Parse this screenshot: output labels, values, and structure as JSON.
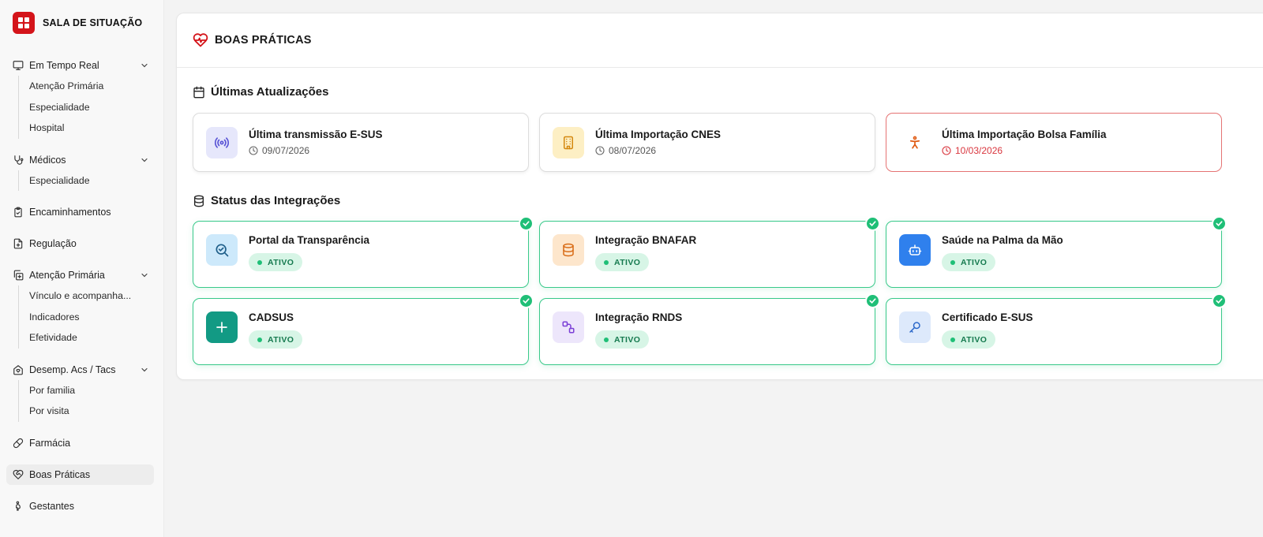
{
  "sidebar": {
    "brand": "SALA DE SITUAÇÃO",
    "groups": [
      {
        "label": "Em Tempo Real",
        "icon": "monitor-icon",
        "items": [
          "Atenção Primária",
          "Especialidade",
          "Hospital"
        ]
      },
      {
        "label": "Médicos",
        "icon": "stethoscope-icon",
        "items": [
          "Especialidade"
        ]
      },
      {
        "label": "Encaminhamentos",
        "icon": "clipboard-icon"
      },
      {
        "label": "Regulação",
        "icon": "file-plus-icon"
      },
      {
        "label": "Atenção Primária",
        "icon": "copy-plus-icon",
        "items": [
          "Vínculo e acompanha...",
          "Indicadores",
          "Efetividade"
        ]
      },
      {
        "label": "Desemp. Acs / Tacs",
        "icon": "house-heart-icon",
        "items": [
          "Por familia",
          "Por visita"
        ]
      },
      {
        "label": "Farmácia",
        "icon": "pill-icon"
      },
      {
        "label": "Boas Práticas",
        "icon": "heart-handshake-icon"
      },
      {
        "label": "Gestantes",
        "icon": "pregnant-icon"
      }
    ]
  },
  "main": {
    "title": "BOAS PRÁTICAS",
    "updates_title": "Últimas Atualizações",
    "updates": [
      {
        "title": "Última transmissão E-SUS",
        "date": "09/07/2026"
      },
      {
        "title": "Última Importação CNES",
        "date": "08/07/2026"
      },
      {
        "title": "Última Importação Bolsa Família",
        "date": "10/03/2026"
      }
    ],
    "integrations_title": "Status das Integrações",
    "integrations": [
      {
        "name": "Portal da Transparência",
        "status": "ATIVO"
      },
      {
        "name": "Integração BNAFAR",
        "status": "ATIVO"
      },
      {
        "name": "Saúde na Palma da Mão",
        "status": "ATIVO"
      },
      {
        "name": "CADSUS",
        "status": "ATIVO"
      },
      {
        "name": "Integração RNDS",
        "status": "ATIVO"
      },
      {
        "name": "Certificado E-SUS",
        "status": "ATIVO"
      }
    ]
  },
  "colors": {
    "brand": "#d4141a",
    "active_green": "#1fbf77",
    "alert_red": "#d9363e"
  }
}
